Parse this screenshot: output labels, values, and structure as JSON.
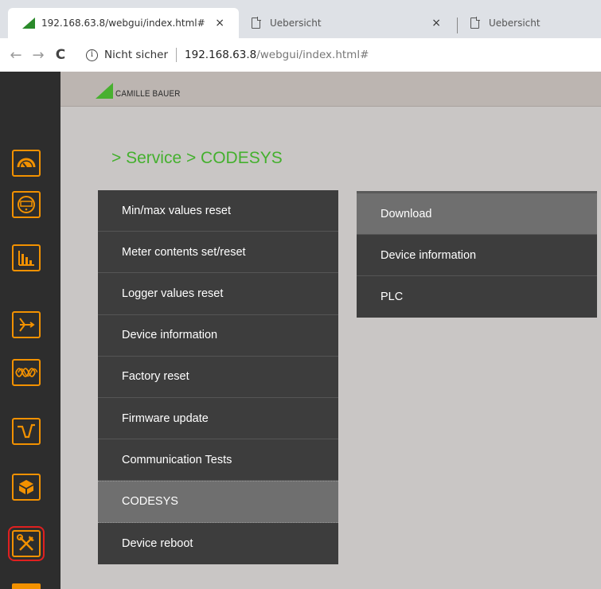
{
  "browser": {
    "tabs": [
      {
        "title": "192.168.63.8/webgui/index.html#",
        "close": "×"
      },
      {
        "title": "Uebersicht",
        "close": "×"
      },
      {
        "title": "Uebersicht"
      }
    ],
    "back": "←",
    "forward": "→",
    "reload": "C",
    "info": "i",
    "security_text": "Nicht sicher",
    "url_host": "192.168.63.8",
    "url_rest": "/webgui/index.html#"
  },
  "header": {
    "logo_text": "CAMILLE BAUER"
  },
  "breadcrumb": "> Service > CODESYS",
  "sidebar": {
    "accent_color": "#f29100",
    "icons": [
      "gauge-icon",
      "meter-display-icon",
      "bar-chart-icon",
      "vector-diagram-icon",
      "waveform-icon",
      "trend-icon",
      "box-icon",
      "tools-icon"
    ],
    "selected": "tools-icon"
  },
  "menu": {
    "items": [
      "Min/max values reset",
      "Meter contents set/reset",
      "Logger values reset",
      "Device information",
      "Factory reset",
      "Firmware update",
      "Communication Tests",
      "CODESYS",
      "Device reboot"
    ],
    "active": "CODESYS"
  },
  "submenu": {
    "items": [
      "Download",
      "Device information",
      "PLC"
    ],
    "active": "Download"
  },
  "colors": {
    "brand_green": "#44b02e",
    "panel_dark": "#3d3d3d",
    "panel_active": "#6f6f6f"
  }
}
